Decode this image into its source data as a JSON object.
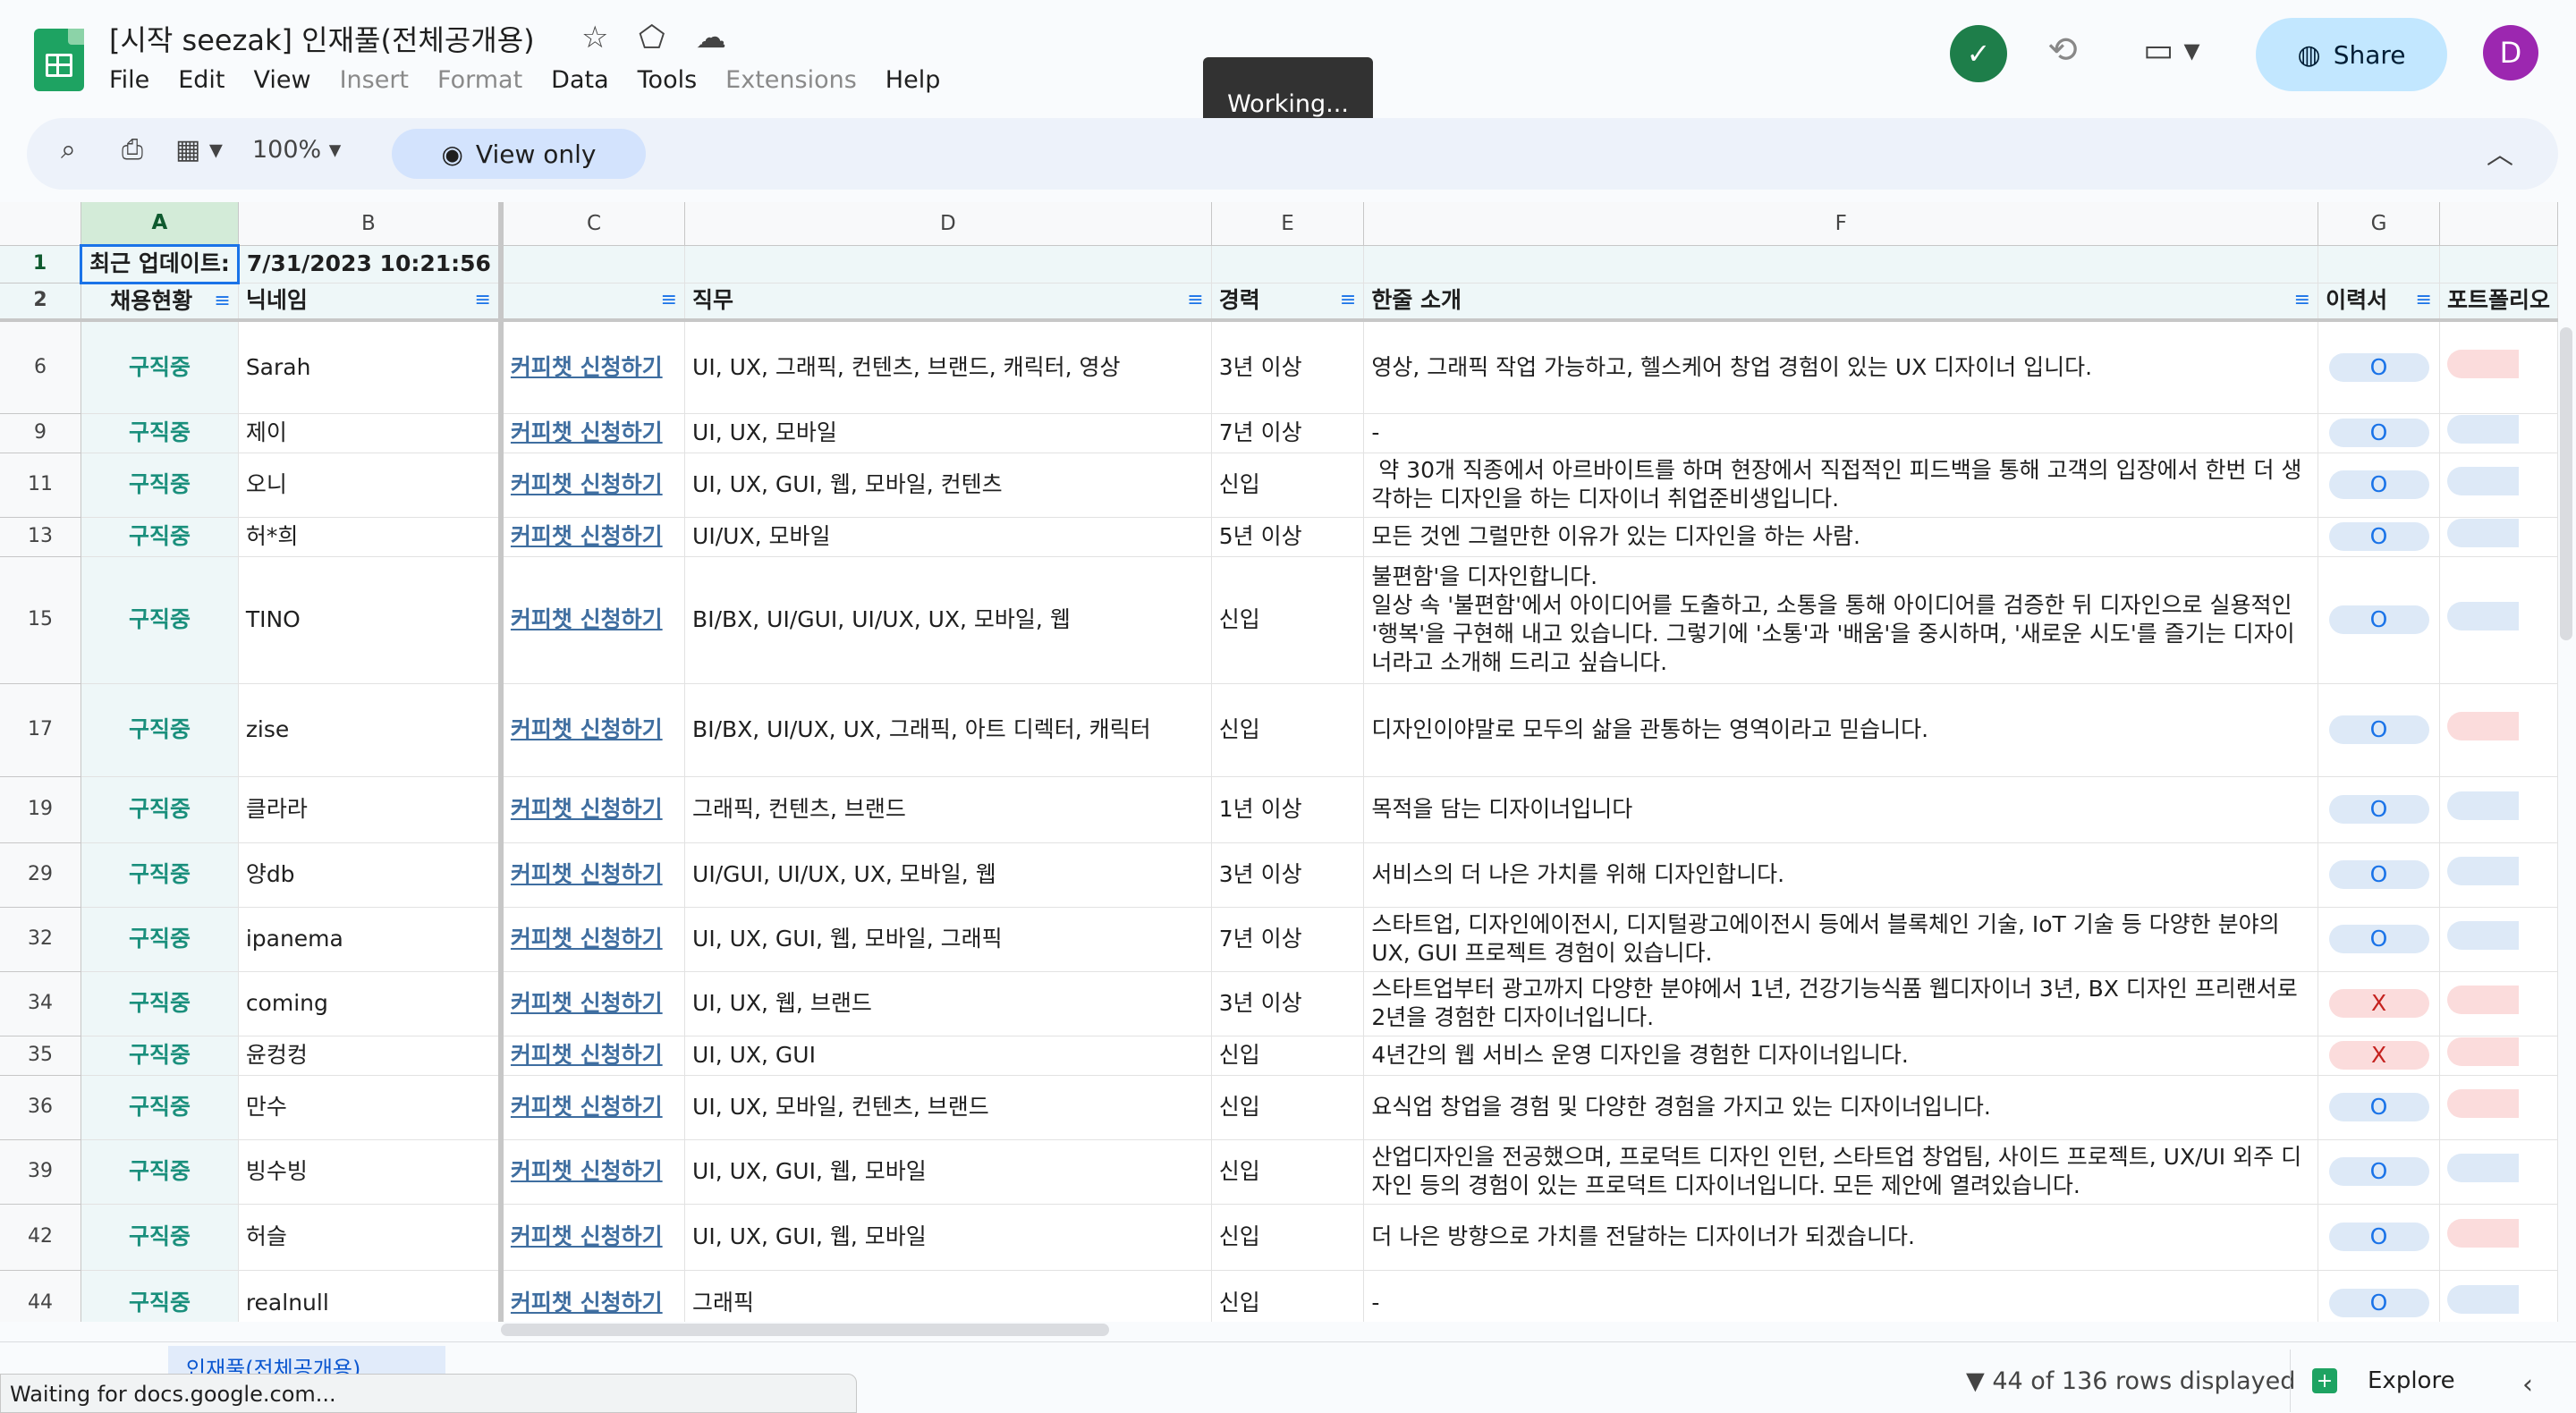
{
  "doc": {
    "title": "[시작 seezak] 인재풀(전체공개용)"
  },
  "menu": [
    "File",
    "Edit",
    "View",
    "Insert",
    "Format",
    "Data",
    "Tools",
    "Extensions",
    "Help"
  ],
  "menu_disabled": [
    false,
    false,
    false,
    true,
    true,
    false,
    false,
    true,
    false
  ],
  "toast": "Working...",
  "share_label": "Share",
  "avatar_letter": "D",
  "toolbar": {
    "zoom": "100%",
    "view_only": "View only"
  },
  "columns": [
    "A",
    "B",
    "C",
    "D",
    "E",
    "F",
    "G"
  ],
  "row1": {
    "rn": "1",
    "label": "최근 업데이트:",
    "value": "7/31/2023 10:21:56"
  },
  "row2": {
    "rn": "2",
    "headers": [
      "채용현황",
      "닉네임",
      "",
      "직무",
      "경력",
      "한줄 소개",
      "이력서",
      "포트폴리오"
    ]
  },
  "rows": [
    {
      "rn": "6",
      "status": "구직중",
      "nick": "Sarah",
      "link": "커피챗 신청하기",
      "role": "UI, UX, 그래픽, 컨텐츠, 브랜드, 캐릭터, 영상",
      "exp": "3년 이상",
      "intro": "영상, 그래픽 작업 가능하고, 헬스케어 창업 경험이 있는 UX 디자이너 입니다.",
      "cv": "O",
      "pf": "red"
    },
    {
      "rn": "9",
      "status": "구직중",
      "nick": "제이",
      "link": "커피챗 신청하기",
      "role": "UI, UX, 모바일",
      "exp": "7년 이상",
      "intro": "-",
      "cv": "O",
      "pf": "blue"
    },
    {
      "rn": "11",
      "status": "구직중",
      "nick": "오니",
      "link": "커피챗 신청하기",
      "role": "UI, UX, GUI, 웹, 모바일, 컨텐츠",
      "exp": "신입",
      "intro": " 약 30개 직종에서 아르바이트를 하며 현장에서 직접적인 피드백을 통해 고객의 입장에서 한번 더 생각하는 디자인을 하는 디자이너 취업준비생입니다.",
      "cv": "O",
      "pf": "blue"
    },
    {
      "rn": "13",
      "status": "구직중",
      "nick": "허*희",
      "link": "커피챗 신청하기",
      "role": "UI/UX, 모바일",
      "exp": "5년 이상",
      "intro": "모든 것엔 그럴만한 이유가 있는 디자인을 하는 사람.",
      "cv": "O",
      "pf": "blue"
    },
    {
      "rn": "15",
      "status": "구직중",
      "nick": "TINO",
      "link": "커피챗 신청하기",
      "role": "BI/BX, UI/GUI, UI/UX, UX, 모바일, 웹",
      "exp": "신입",
      "intro": "불편함'을 디자인합니다.\n일상 속 '불편함'에서 아이디어를 도출하고, 소통을 통해 아이디어를 검증한 뒤 디자인으로 실용적인 '행복'을 구현해 내고 있습니다. 그렇기에 '소통'과 '배움'을 중시하며, '새로운 시도'를 즐기는 디자이너라고 소개해 드리고 싶습니다.",
      "cv": "O",
      "pf": "blue"
    },
    {
      "rn": "17",
      "status": "구직중",
      "nick": "zise",
      "link": "커피챗 신청하기",
      "role": "BI/BX, UI/UX, UX, 그래픽, 아트 디렉터, 캐릭터",
      "exp": "신입",
      "intro": "디자인이야말로 모두의 삶을 관통하는 영역이라고 믿습니다.",
      "cv": "O",
      "pf": "red"
    },
    {
      "rn": "19",
      "status": "구직중",
      "nick": "클라라",
      "link": "커피챗 신청하기",
      "role": "그래픽, 컨텐츠, 브랜드",
      "exp": "1년 이상",
      "intro": "목적을 담는 디자이너입니다",
      "cv": "O",
      "pf": "blue"
    },
    {
      "rn": "29",
      "status": "구직중",
      "nick": "양db",
      "link": "커피챗 신청하기",
      "role": "UI/GUI, UI/UX, UX, 모바일, 웹",
      "exp": "3년 이상",
      "intro": "서비스의 더 나은 가치를 위해 디자인합니다.",
      "cv": "O",
      "pf": "blue"
    },
    {
      "rn": "32",
      "status": "구직중",
      "nick": "ipanema",
      "link": "커피챗 신청하기",
      "role": "UI, UX, GUI, 웹, 모바일, 그래픽",
      "exp": "7년 이상",
      "intro": "스타트업, 디자인에이전시, 디지털광고에이전시 등에서 블록체인 기술, IoT 기술 등 다양한 분야의 UX, GUI 프로젝트 경험이 있습니다.",
      "cv": "O",
      "pf": "blue"
    },
    {
      "rn": "34",
      "status": "구직중",
      "nick": "coming",
      "link": "커피챗 신청하기",
      "role": "UI, UX, 웹, 브랜드",
      "exp": "3년 이상",
      "intro": "스타트업부터 광고까지 다양한 분야에서 1년, 건강기능식품 웹디자이너 3년, BX 디자인 프리랜서로 2년을 경험한 디자이너입니다.",
      "cv": "X",
      "pf": "red"
    },
    {
      "rn": "35",
      "status": "구직중",
      "nick": "윤컹컹",
      "link": "커피챗 신청하기",
      "role": "UI, UX, GUI",
      "exp": "신입",
      "intro": "4년간의 웹 서비스 운영 디자인을 경험한 디자이너입니다.",
      "cv": "X",
      "pf": "red"
    },
    {
      "rn": "36",
      "status": "구직중",
      "nick": "만수",
      "link": "커피챗 신청하기",
      "role": "UI, UX, 모바일, 컨텐츠, 브랜드",
      "exp": "신입",
      "intro": "요식업 창업을 경험 및 다양한 경험을 가지고 있는 디자이너입니다.",
      "cv": "O",
      "pf": "red"
    },
    {
      "rn": "39",
      "status": "구직중",
      "nick": "빙수빙",
      "link": "커피챗 신청하기",
      "role": "UI, UX, GUI, 웹, 모바일",
      "exp": "신입",
      "intro": "산업디자인을 전공했으며, 프로덕트 디자인 인턴, 스타트업 창업팀, 사이드 프로젝트, UX/UI 외주 디자인 등의 경험이 있는 프로덕트 디자이너입니다. 모든 제안에 열려있습니다.",
      "cv": "O",
      "pf": "blue"
    },
    {
      "rn": "42",
      "status": "구직중",
      "nick": "허슬",
      "link": "커피챗 신청하기",
      "role": "UI, UX, GUI, 웹, 모바일",
      "exp": "신입",
      "intro": "더 나은 방향으로 가치를 전달하는 디자이너가 되겠습니다.",
      "cv": "O",
      "pf": "red"
    },
    {
      "rn": "44",
      "status": "구직중",
      "nick": "realnull",
      "link": "커피챗 신청하기",
      "role": "그래픽",
      "exp": "신입",
      "intro": "-",
      "cv": "O",
      "pf": "blue"
    }
  ],
  "bottom": {
    "sheet_tab": "인재풀(전체공개용)",
    "rows_displayed": "44 of 136 rows displayed",
    "explore": "Explore"
  },
  "statusbar": "Waiting for docs.google.com..."
}
